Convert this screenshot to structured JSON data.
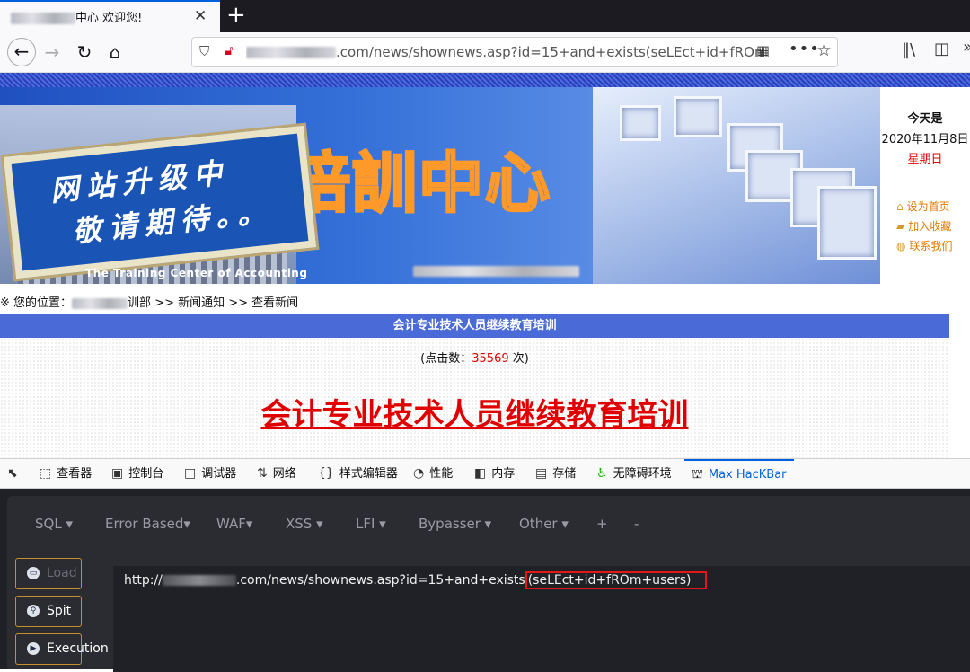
{
  "tab": {
    "title_suffix": "中心 欢迎您!",
    "close": "✕",
    "new_tab": "+"
  },
  "nav": {
    "back": "←",
    "forward": "→",
    "reload": "↻",
    "home": "⌂",
    "url_visible": ".com/news/shownews.asp?id=15+and+exists(seLEct+id+fROm+u",
    "icons": [
      "shield-icon",
      "insecure-lock-icon",
      "qr-code-icon",
      "more-icon",
      "bookmark-star-icon",
      "library-icon",
      "sidebar-icon",
      "overflow-icon"
    ]
  },
  "banner": {
    "title": "会計培訓中心",
    "scroll_line1": "网站升级中",
    "scroll_line2": "敬请期待。。",
    "english": "The Training Center of Accounting"
  },
  "datebox": {
    "label": "今天是",
    "date": "2020年11月8日",
    "weekday": "星期日",
    "links": [
      "设为首页",
      "加入收藏",
      "联系我们"
    ]
  },
  "breadcrumb": {
    "prefix": "※ 您的位置：",
    "mid": "训部",
    "rest": " >> 新闻通知 >> 查看新闻"
  },
  "article": {
    "header": "会计专业技术人员继续教育培训",
    "clicks_prefix": "(点击数：",
    "clicks_value": "35569",
    "clicks_suffix": " 次)",
    "title": "会计专业技术人员继续教育培训"
  },
  "devtools": {
    "tabs": [
      {
        "icon": "⬚",
        "label": "查看器"
      },
      {
        "icon": "▣",
        "label": "控制台"
      },
      {
        "icon": "◫",
        "label": "调试器"
      },
      {
        "icon": "⇅",
        "label": "网络"
      },
      {
        "icon": "{}",
        "label": "样式编辑器"
      },
      {
        "icon": "◔",
        "label": "性能"
      },
      {
        "icon": "◧",
        "label": "内存"
      },
      {
        "icon": "▤",
        "label": "存储"
      },
      {
        "icon": "♿",
        "label": "无障碍环境"
      },
      {
        "icon": "⛫",
        "label": "Max HacKBar"
      }
    ]
  },
  "hackbar": {
    "menus": [
      "SQL ▾",
      "Error Based▾",
      "WAF▾",
      "XSS ▾",
      "LFI ▾",
      "Bypasser ▾",
      "Other ▾",
      "+",
      "-"
    ],
    "buttons": [
      "Load URL",
      "Spit URL",
      "Execution"
    ],
    "url_prefix": "http://",
    "url_mid": ".com/news/shownews.asp?id=15+and+exists",
    "url_highlight": "(seLEct+id+fROm+users)"
  }
}
